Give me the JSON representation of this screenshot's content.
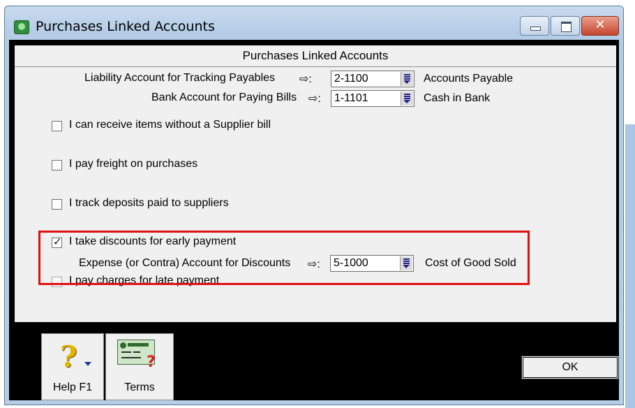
{
  "window": {
    "title": "Purchases Linked Accounts",
    "close_glyph": "✕"
  },
  "panel": {
    "header": "Purchases Linked Accounts",
    "liability": {
      "label": "Liability Account for Tracking Payables",
      "arrow": "⇨:",
      "value": "2-1100",
      "account_name": "Accounts Payable"
    },
    "bank": {
      "label": "Bank Account for Paying Bills",
      "arrow": "⇨:",
      "value": "1-1101",
      "account_name": "Cash in Bank"
    },
    "checkboxes": {
      "receive_items": {
        "label": "I can receive items without a Supplier bill",
        "checked": false
      },
      "freight": {
        "label": "I pay freight on purchases",
        "checked": false
      },
      "deposits": {
        "label": "I track deposits paid to suppliers",
        "checked": false
      },
      "discounts": {
        "label": "I take discounts for early payment",
        "checked": true
      },
      "late_charges": {
        "label": "I pay charges for late payment",
        "checked": false
      }
    },
    "discount_account": {
      "label": "Expense (or Contra) Account for Discounts",
      "arrow": "⇨:",
      "value": "5-1000",
      "account_name": "Cost of Good Sold"
    }
  },
  "footer": {
    "help_label": "Help F1",
    "help_glyph": "?",
    "terms_label": "Terms",
    "terms_glyph": "?",
    "ok_label": "OK"
  },
  "colors": {
    "highlight": "#e01010",
    "title_bar": "#b6cde6",
    "client_bg": "#000000",
    "panel_bg": "#f0f0f0"
  },
  "icons": [
    "app-icon",
    "minimize-icon",
    "maximize-icon",
    "close-icon",
    "arrow-right-icon",
    "dropdown-icon",
    "help-icon",
    "terms-icon"
  ]
}
